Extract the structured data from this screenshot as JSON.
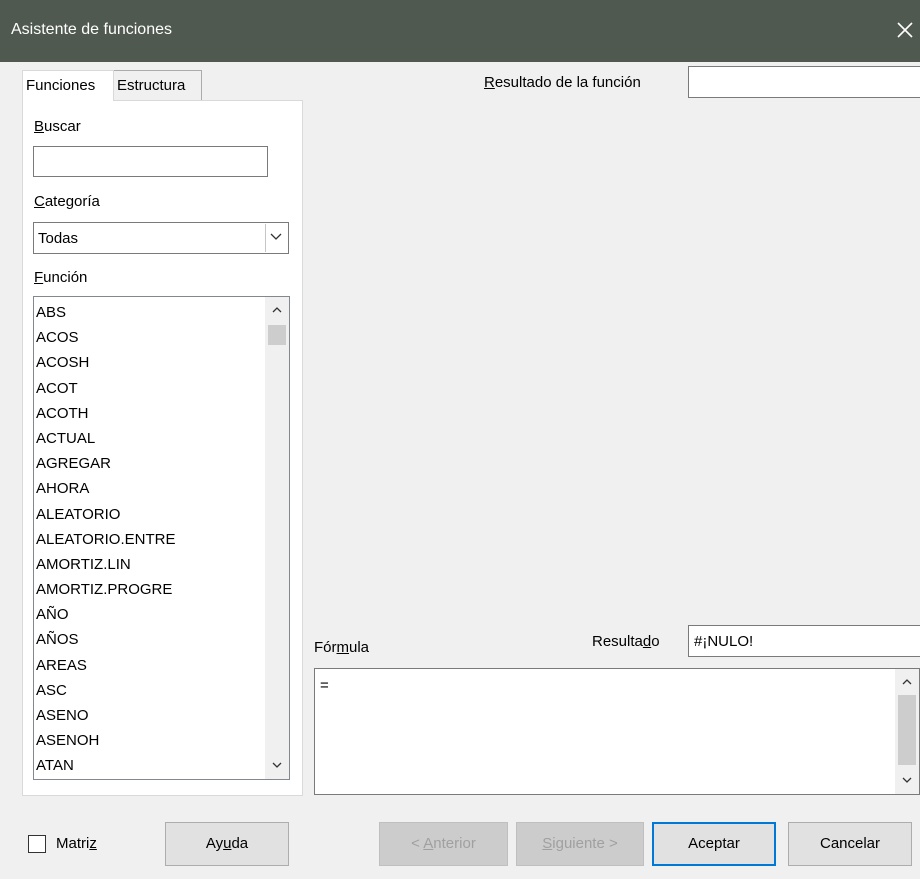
{
  "window": {
    "title": "Asistente de funciones"
  },
  "tabs": [
    {
      "label": "Funciones",
      "active": true
    },
    {
      "label": "Estructura",
      "active": false
    }
  ],
  "search": {
    "label_key": "B",
    "label_rest": "uscar",
    "value": ""
  },
  "category": {
    "label_key": "C",
    "label_rest": "ategoría",
    "selected": "Todas"
  },
  "function_list": {
    "label_key": "F",
    "label_rest": "unción",
    "items": [
      "ABS",
      "ACOS",
      "ACOSH",
      "ACOT",
      "ACOTH",
      "ACTUAL",
      "AGREGAR",
      "AHORA",
      "ALEATORIO",
      "ALEATORIO.ENTRE",
      "AMORTIZ.LIN",
      "AMORTIZ.PROGRE",
      "AÑO",
      "AÑOS",
      "AREAS",
      "ASC",
      "ASENO",
      "ASENOH",
      "ATAN"
    ]
  },
  "function_result": {
    "label_key": "R",
    "label_rest": "esultado de la función",
    "value": ""
  },
  "formula": {
    "label_pre": "Fór",
    "label_key": "m",
    "label_rest": "ula",
    "value": "="
  },
  "result": {
    "label_pre": "Resulta",
    "label_key": "d",
    "label_rest": "o",
    "value": "#¡NULO!"
  },
  "footer": {
    "matrix": {
      "label_pre": "Matri",
      "label_key": "z",
      "checked": false
    },
    "help": {
      "pre": "Ay",
      "key": "u",
      "rest": "da"
    },
    "back": {
      "pre": "< ",
      "key": "A",
      "rest": "nterior"
    },
    "next": {
      "pre": "",
      "key": "S",
      "rest": "iguiente >"
    },
    "ok": "Aceptar",
    "cancel": "Cancelar"
  }
}
